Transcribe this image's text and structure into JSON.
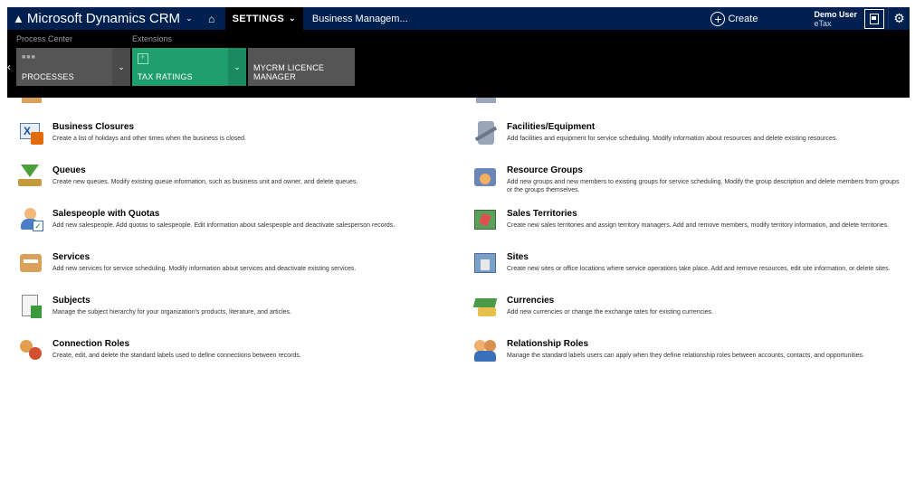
{
  "topbar": {
    "app_title": "Microsoft Dynamics CRM",
    "settings_label": "SETTINGS",
    "breadcrumb": "Business Managem...",
    "create_label": "Create",
    "user_name": "Demo User",
    "user_org": "eTax"
  },
  "subnav": {
    "groups": [
      {
        "label": "Process Center"
      },
      {
        "label": "Extensions"
      }
    ],
    "tiles": [
      {
        "label": "PROCESSES",
        "color": "#555555"
      },
      {
        "label": "TAX RATINGS",
        "color": "#1f9e6e"
      },
      {
        "label": "MYCRM LICENCE MANAGER",
        "color": "#555555"
      }
    ]
  },
  "items": [
    {
      "title": "Business Closures",
      "desc": "Create a list of holidays and other times when the business is closed.",
      "icon": "business-closures-icon"
    },
    {
      "title": "Facilities/Equipment",
      "desc": "Add facilities and equipment for service scheduling. Modify information about resources and delete existing resources.",
      "icon": "facilities-equipment-icon"
    },
    {
      "title": "Queues",
      "desc": "Create new queues. Modify existing queue information, such as business unit and owner, and delete queues.",
      "icon": "queues-icon"
    },
    {
      "title": "Resource Groups",
      "desc": "Add new groups and new members to existing groups for service scheduling. Modify the group description and delete members from groups or the groups themselves.",
      "icon": "resource-groups-icon"
    },
    {
      "title": "Salespeople with Quotas",
      "desc": "Add new salespeople. Add quotas to salespeople. Edit information about salespeople and deactivate salesperson records.",
      "icon": "salespeople-icon"
    },
    {
      "title": "Sales Territories",
      "desc": "Create new sales territories and assign territory managers. Add and remove members, modify territory information, and delete territories.",
      "icon": "sales-territories-icon"
    },
    {
      "title": "Services",
      "desc": "Add new services for service scheduling. Modify information about services and deactivate existing services.",
      "icon": "services-icon"
    },
    {
      "title": "Sites",
      "desc": "Create new sites or office locations where service operations take place. Add and remove resources, edit site information, or delete sites.",
      "icon": "sites-icon"
    },
    {
      "title": "Subjects",
      "desc": "Manage the subject hierarchy for your organization's products, literature, and articles.",
      "icon": "subjects-icon"
    },
    {
      "title": "Currencies",
      "desc": "Add new currencies or change the exchange rates for existing currencies.",
      "icon": "currencies-icon"
    },
    {
      "title": "Connection Roles",
      "desc": "Create, edit, and delete the standard labels used to define connections between records.",
      "icon": "connection-roles-icon"
    },
    {
      "title": "Relationship Roles",
      "desc": "Manage the standard labels users can apply when they define relationship roles between accounts, contacts, and opportunities.",
      "icon": "relationship-roles-icon"
    }
  ]
}
